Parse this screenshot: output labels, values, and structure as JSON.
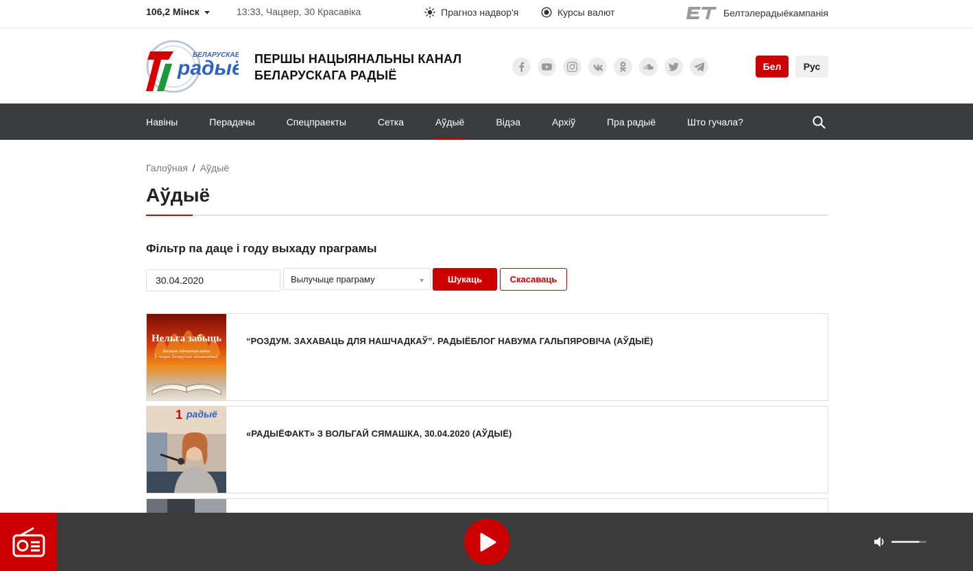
{
  "topbar": {
    "frequency": "106,2 Мінск",
    "datetime": "13:33, Чацвер, 30 Красавіка",
    "weather_label": "Прагноз надвор'я",
    "rates_label": "Курсы валют",
    "company_label": "Белтэлерадыёкампанія"
  },
  "header": {
    "logo_text_small": "БЕЛАРУСКАЕ",
    "logo_text_main": "радыё",
    "logo_number": "1",
    "title_line1": "ПЕРШЫ НАЦЫЯНАЛЬНЫ КАНАЛ",
    "title_line2": "БЕЛАРУСКАГА РАДЫЁ",
    "socials": [
      "facebook-icon",
      "youtube-icon",
      "instagram-icon",
      "vk-icon",
      "odnoklassniki-icon",
      "soundcloud-icon",
      "twitter-icon",
      "telegram-icon"
    ],
    "lang_be": "Бел",
    "lang_ru": "Рус"
  },
  "nav": {
    "items": [
      {
        "label": "Навіны"
      },
      {
        "label": "Перадачы"
      },
      {
        "label": "Спецпраекты"
      },
      {
        "label": "Сетка"
      },
      {
        "label": "Аўдыё",
        "active": true
      },
      {
        "label": "Відэа"
      },
      {
        "label": "Архіў"
      },
      {
        "label": "Пра радыё"
      },
      {
        "label": "Што гучала?"
      }
    ]
  },
  "breadcrumb": {
    "home": "Галоўная",
    "separator": "/",
    "current": "Аўдыё"
  },
  "page": {
    "title": "Аўдыё"
  },
  "filter": {
    "heading": "Фільтр па даце і году выхаду праграмы",
    "date_value": "30.04.2020",
    "program_placeholder": "Вылучыце праграму",
    "search_label": "Шукаць",
    "cancel_label": "Скасаваць"
  },
  "audio_items": [
    {
      "title": "“РОЗДУМ. ЗАХАВАЦЬ ДЛЯ НАШЧАДКАЎ”. РАДЫЁБЛОГ НАВУМА ГАЛЬПЯРОВІЧА (АЎДЫЁ)",
      "thumb_heading": "Нельга забыць",
      "thumb_line1": "Вялікая Айчынная вайна",
      "thumb_line2": "ў творах беларускіх пісьменнікаў"
    },
    {
      "title": "«РАДЫЁФАКТ» З ВОЛЬГАЙ СЯМАШКА, 30.04.2020 (АЎДЫЁ)",
      "thumb_logo": "радыё"
    },
    {
      "title": ""
    }
  ],
  "player": {
    "volume_level": 0.8
  },
  "colors": {
    "accent": "#cc0000",
    "nav_bg": "#3a3d40",
    "player_bg": "#3b3b3b"
  }
}
